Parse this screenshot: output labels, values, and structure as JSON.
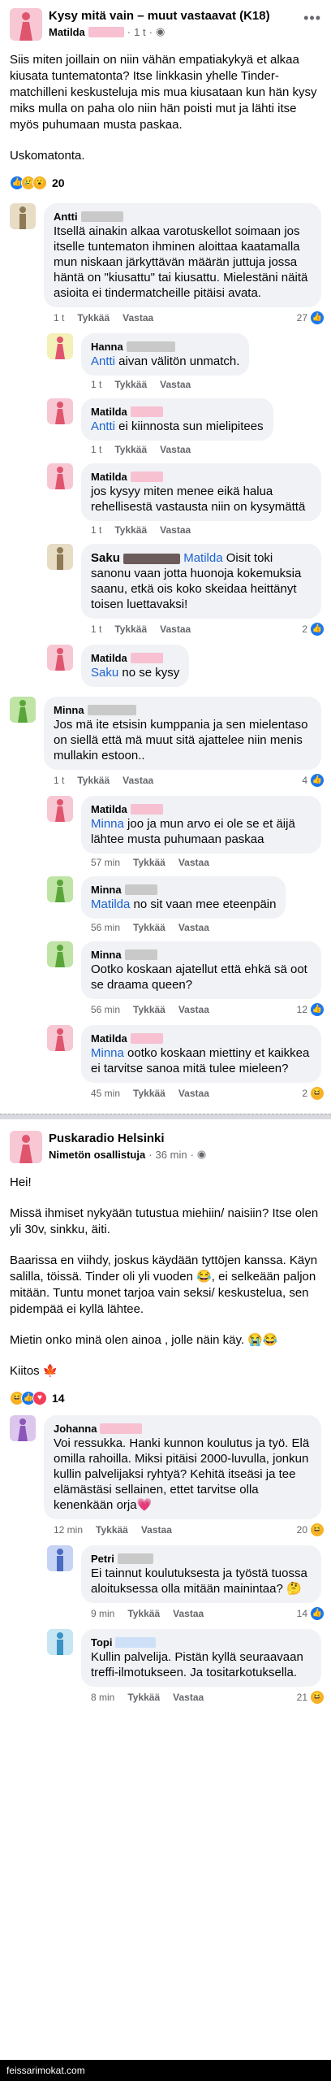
{
  "colors": {
    "blur_pink": "#f7c1d1",
    "blur_gray": "#c9c9c9",
    "blur_blue": "#cde0f7",
    "av_pink": "#f7c7d4",
    "av_green": "#bfe4a6",
    "av_tan": "#e7dcc4",
    "av_yellow": "#f4f0b7",
    "av_purple": "#ddc6ec",
    "av_blue": "#c6e6f4",
    "mention": "#1b63d1",
    "link": "#65676b"
  },
  "post1": {
    "title": "Kysy mitä vain – muut vastaavat (K18)",
    "author": "Matilda",
    "time": "1 t",
    "body1": "Siis miten joillain on niin vähän empatiakykyä et alkaa kiusata tuntematonta? Itse linkkasin yhelle Tinder-matchilleni keskusteluja mis mua kiusataan kun hän kysy miks mulla on paha olo niin hän poisti mut ja lähti itse myös puhumaan musta paskaa.",
    "body2": "Uskomatonta.",
    "reactions": "20"
  },
  "labels": {
    "like": "Tykkää",
    "reply": "Vastaa"
  },
  "comments": [
    {
      "name": "Antti",
      "text": "Itsellä ainakin alkaa varotuskellot soimaan jos itselle tuntematon ihminen aloittaa kaatamalla mun niskaan järkyttävän määrän juttuja jossa häntä on \"kiusattu\" tai kiusattu. Mielestäni näitä asioita ei tindermatcheille pitäisi avata.",
      "time": "1 t",
      "count": "27"
    },
    {
      "name": "Hanna",
      "mention": "Antti",
      "text": " aivan välitön unmatch.",
      "time": "1 t"
    },
    {
      "name": "Matilda",
      "mention": "Antti",
      "text": " ei kiinnosta sun mielipitees",
      "time": "1 t"
    },
    {
      "name": "Matilda",
      "text": "jos kysyy miten menee eikä halua rehellisestä vastausta niin on kysymättä",
      "time": "1 t"
    },
    {
      "name": "Saku",
      "mention": "Matilda",
      "text": " Oisit toki sanonu vaan jotta huonoja kokemuksia saanu, etkä ois koko skeidaa heittänyt toisen luettavaksi!",
      "time": "1 t",
      "count": "2"
    },
    {
      "name": "Matilda",
      "mention": "Saku",
      "text": " no se kysy",
      "time": "1 t"
    },
    {
      "name": "Minna",
      "text": "Jos mä ite etsisin kumppania ja sen mielentaso on siellä että mä muut sitä ajattelee niin menis mullakin estoon..",
      "time": "1 t",
      "count": "4"
    },
    {
      "name": "Matilda",
      "mention": "Minna",
      "text": " joo ja mun arvo ei ole se et äijä lähtee musta puhumaan paskaa",
      "time": "57 min"
    },
    {
      "name": "Minna",
      "mention": "Matilda",
      "text": " no sit vaan mee eteenpäin",
      "time": "56 min"
    },
    {
      "name": "Minna",
      "text": "Ootko koskaan ajatellut että ehkä sä oot se draama queen?",
      "time": "56 min",
      "count": "12"
    },
    {
      "name": "Matilda",
      "mention": "Minna",
      "text": " ootko koskaan miettiny et kaikkea ei tarvitse sanoa mitä tulee mieleen?",
      "time": "45 min",
      "count": "2"
    }
  ],
  "post2": {
    "title": "Puskaradio Helsinki",
    "author": "Nimetön osallistuja",
    "time": "36 min",
    "p1": "Hei!",
    "p2": "Missä ihmiset nykyään tutustua miehiin/ naisiin? Itse olen yli 30v, sinkku, äiti.",
    "p3": "Baarissa en viihdy, joskus käydään tyttöjen kanssa. Käyn salilla, töissä. Tinder oli yli vuoden 😂, ei selkeään paljon mitään. Tuntu monet tarjoa vain seksi/ keskustelua, sen pidempää ei kyllä lähtee.",
    "p4": "Mietin onko minä olen ainoa , jolle näin käy. 😭😂",
    "p5": "Kiitos 🍁",
    "reactions": "14"
  },
  "comments2": [
    {
      "name": "Johanna",
      "text": "Voi ressukka. Hanki kunnon koulutus ja työ. Elä omilla rahoilla. Miksi pitäisi 2000-luvulla, jonkun kullin palvelijaksi ryhtyä? Kehitä itseäsi ja tee elämästäsi sellainen, ettet tarvitse olla kenenkään orja💗",
      "time": "12 min",
      "count": "20"
    },
    {
      "name": "Petri",
      "text": "Ei tainnut koulutuksesta ja työstä tuossa aloituksessa olla mitään mainintaa? 🤔",
      "time": "9 min",
      "count": "14"
    },
    {
      "name": "Topi",
      "text": "Kullin palvelija. Pistän kyllä seuraavaan treffi-ilmotukseen. Ja tosi­tarkotuksella.",
      "time": "8 min",
      "count": "21"
    }
  ],
  "footer": "feissarimokat.com"
}
